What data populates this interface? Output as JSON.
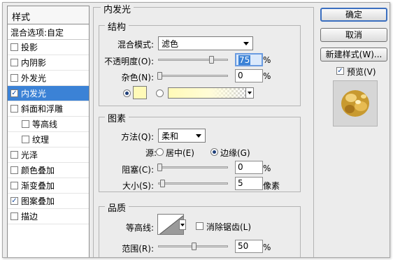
{
  "style_list": {
    "header": "样式",
    "blend_options": "混合选项:自定",
    "items": [
      {
        "label": "投影",
        "checked": false,
        "sub": false,
        "active": false
      },
      {
        "label": "内阴影",
        "checked": false,
        "sub": false,
        "active": false
      },
      {
        "label": "外发光",
        "checked": false,
        "sub": false,
        "active": false
      },
      {
        "label": "内发光",
        "checked": true,
        "sub": false,
        "active": true
      },
      {
        "label": "斜面和浮雕",
        "checked": false,
        "sub": false,
        "active": false
      },
      {
        "label": "等高线",
        "checked": false,
        "sub": true,
        "active": false
      },
      {
        "label": "纹理",
        "checked": false,
        "sub": true,
        "active": false
      },
      {
        "label": "光泽",
        "checked": false,
        "sub": false,
        "active": false
      },
      {
        "label": "颜色叠加",
        "checked": false,
        "sub": false,
        "active": false
      },
      {
        "label": "渐变叠加",
        "checked": false,
        "sub": false,
        "active": false
      },
      {
        "label": "图案叠加",
        "checked": true,
        "sub": false,
        "active": false
      },
      {
        "label": "描边",
        "checked": false,
        "sub": false,
        "active": false
      }
    ]
  },
  "panel": {
    "title": "内发光",
    "structure": {
      "title": "结构",
      "blend_mode_label": "混合模式:",
      "blend_mode_value": "滤色",
      "opacity_label": "不透明度(O):",
      "opacity_value": "75",
      "noise_label": "杂色(N):",
      "noise_value": "0",
      "percent": "%",
      "color_swatch": "#fffab8"
    },
    "elements": {
      "title": "图素",
      "method_label": "方法(Q):",
      "method_value": "柔和",
      "source_label": "源:",
      "source_center": "居中(E)",
      "source_edge": "边缘(G)",
      "choke_label": "阻塞(C):",
      "choke_value": "0",
      "size_label": "大小(S):",
      "size_value": "5",
      "percent": "%",
      "pixels": "像素"
    },
    "quality": {
      "title": "品质",
      "contour_label": "等高线:",
      "antialias_label": "消除锯齿(L)",
      "range_label": "范围(R):",
      "range_value": "50",
      "percent": "%"
    }
  },
  "buttons": {
    "ok": "确定",
    "cancel": "取消",
    "new_style": "新建样式(W)...",
    "preview_label": "预览(V)",
    "preview_checked": true
  }
}
